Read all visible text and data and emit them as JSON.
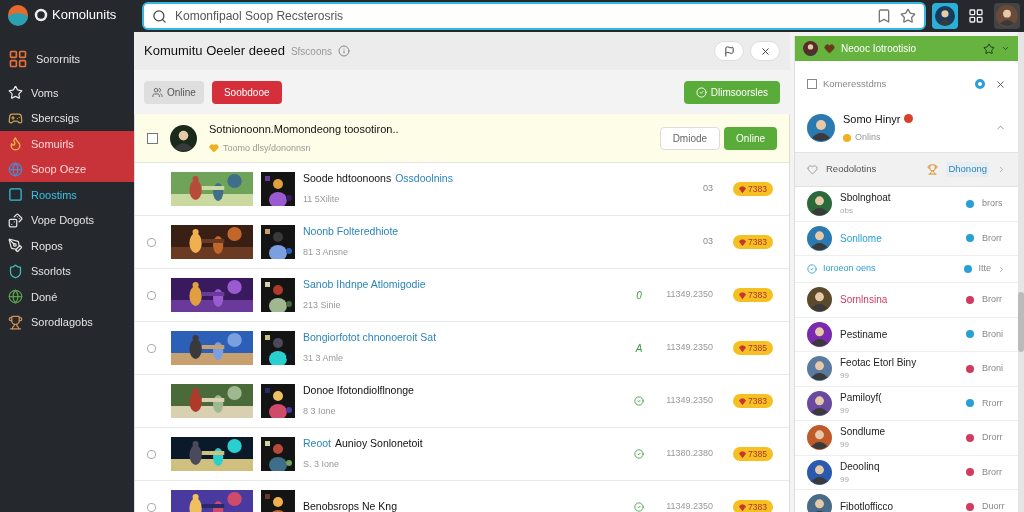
{
  "app": {
    "name": "Komolunits"
  },
  "search": {
    "placeholder": "Komonfipaol Soop Recsterosris"
  },
  "sidebar": {
    "items": [
      {
        "label": "Sorornits",
        "selected": false,
        "highlighted": false
      },
      {
        "label": "Voms",
        "selected": false,
        "highlighted": false
      },
      {
        "label": "Sbercsigs",
        "selected": false,
        "highlighted": false
      },
      {
        "label": "Somuirls",
        "selected": true,
        "highlighted": false
      },
      {
        "label": "Soop Oeze",
        "selected": true,
        "highlighted": false
      },
      {
        "label": "Roostims",
        "selected": false,
        "highlighted": true
      },
      {
        "label": "Vope Dogots",
        "selected": false,
        "highlighted": false
      },
      {
        "label": "Ropos",
        "selected": false,
        "highlighted": false
      },
      {
        "label": "Ssorlots",
        "selected": false,
        "highlighted": false
      },
      {
        "label": "Doné",
        "selected": false,
        "highlighted": false
      },
      {
        "label": "Sorodlagobs",
        "selected": false,
        "highlighted": false
      }
    ]
  },
  "header": {
    "title": "Komumitu Oeeler deeed",
    "subtitle": "Sfscoons"
  },
  "toolbar": {
    "filter": "Online",
    "primary": "Soobdooe",
    "action": "Dlimsoorsles"
  },
  "featured": {
    "checked": false,
    "title": "Sotnionoonn.Momondeong toosotiron..",
    "subtitle": "Toomo dlsy/dononnsn",
    "buttons": [
      "Dmiode",
      "Online"
    ]
  },
  "rows": [
    {
      "checkbox": false,
      "title_parts": [
        {
          "text": "Soode hdtoonoons",
          "link": false
        },
        {
          "text": "Ossdoolnins",
          "link": true
        }
      ],
      "subtitle": "11 5Xilite",
      "status": {
        "kind": "text",
        "text": "03"
      },
      "badge": "7383"
    },
    {
      "checkbox": true,
      "title_parts": [
        {
          "text": "Noonb Folteredhiote",
          "link": true
        }
      ],
      "subtitle": "81 3 Ansne",
      "status": {
        "kind": "text",
        "text": "03"
      },
      "badge": "7383"
    },
    {
      "checkbox": true,
      "title_parts": [
        {
          "text": "Sanob Ihdnpe Atlomigodie",
          "link": true
        }
      ],
      "subtitle": "213 Sinie",
      "status": {
        "kind": "green",
        "text": "0"
      },
      "date": "11349.2350",
      "badge": "7383"
    },
    {
      "checkbox": true,
      "title_parts": [
        {
          "text": "Bongiorfotot chnonoeroit Sat",
          "link": true
        }
      ],
      "subtitle": "31 3 Amle",
      "status": {
        "kind": "green",
        "text": "A"
      },
      "date": "11349.2350",
      "badge": "7385"
    },
    {
      "checkbox": false,
      "title_parts": [
        {
          "text": "Donoe Ifotondiolflnonge",
          "link": false
        }
      ],
      "subtitle": "8 3 Ione",
      "status": {
        "kind": "check"
      },
      "date": "11349.2350",
      "badge": "7383"
    },
    {
      "checkbox": true,
      "title_parts": [
        {
          "text": "Reoot",
          "link": true
        },
        {
          "text": "Aunioy Sonlonetoit",
          "link": false
        }
      ],
      "subtitle": "S. 3 Ione",
      "status": {
        "kind": "check"
      },
      "date": "11380.2380",
      "badge": "7385"
    },
    {
      "checkbox": true,
      "title_parts": [
        {
          "text": "Benobsrops  Ne Kng",
          "link": false
        }
      ],
      "status": {
        "kind": "check"
      },
      "date": "11349.2350",
      "badge": "7383"
    }
  ],
  "panel": {
    "title": "Neooc Iotrootisio",
    "filter": {
      "label": "Komeresstdms",
      "checked": false
    },
    "profile": {
      "name": "Somo Hinyr",
      "status": "Onlins",
      "expanded": true
    },
    "section": {
      "label": "Reodolotins",
      "link": "Dhonong"
    },
    "friends": [
      {
        "kind": "friend",
        "name": "Sbolnghoat",
        "sub": "obs",
        "action": "brors",
        "color": "#2a9fd6",
        "highlight": false
      },
      {
        "kind": "friend",
        "name": "Sonllome",
        "action": "Brorr",
        "color": "#2a9fd6",
        "highlight": true
      },
      {
        "kind": "group",
        "name": "Ioroeon oens",
        "action": "Itte",
        "color": "#2a9fd6",
        "highlight": true
      },
      {
        "kind": "friend",
        "name": "Sornlnsina",
        "action": "Brorr",
        "color": "#d23a5f",
        "highlight": true
      },
      {
        "kind": "friend",
        "name": "Pestiname",
        "action": "Broni",
        "color": "#2a9fd6",
        "highlight": false
      },
      {
        "kind": "friend",
        "name": "Feotac Etorl Biny",
        "sub": "99",
        "action": "Broni",
        "color": "#d23a5f",
        "highlight": false
      },
      {
        "kind": "friend",
        "name": "Pamiloyf(",
        "sub": "99",
        "action": "Rrorr",
        "color": "#2a9fd6",
        "highlight": false
      },
      {
        "kind": "friend",
        "name": "Sondlume",
        "sub": "99",
        "action": "Drorr",
        "color": "#d23a5f",
        "highlight": false
      },
      {
        "kind": "friend",
        "name": "Deoolinq",
        "sub": "99",
        "action": "Brorr",
        "color": "#d23a5f",
        "highlight": false
      },
      {
        "kind": "friend",
        "name": "Fibotlofficco",
        "action": "Duorr",
        "color": "#d23a5f",
        "highlight": false
      }
    ]
  }
}
